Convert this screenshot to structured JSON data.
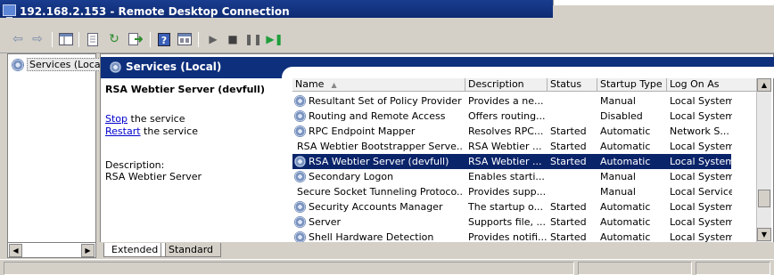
{
  "window": {
    "title": "192.168.2.153 - Remote Desktop Connection"
  },
  "tree": {
    "item_label": "Services (Local)"
  },
  "header": {
    "title": "Services (Local)"
  },
  "detail": {
    "service_name": "RSA Webtier Server (devfull)",
    "stop_link": "Stop",
    "stop_suffix": " the service",
    "restart_link": "Restart",
    "restart_suffix": " the service",
    "description_label": "Description:",
    "description_text": "RSA Webtier Server"
  },
  "columns": {
    "name": "Name",
    "description": "Description",
    "status": "Status",
    "startup": "Startup Type",
    "logon": "Log On As"
  },
  "rows": [
    {
      "name": "Resultant Set of Policy Provider",
      "description": "Provides a ne...",
      "status": "",
      "startup": "Manual",
      "logon": "Local System",
      "selected": false
    },
    {
      "name": "Routing and Remote Access",
      "description": "Offers routing...",
      "status": "",
      "startup": "Disabled",
      "logon": "Local System",
      "selected": false
    },
    {
      "name": "RPC Endpoint Mapper",
      "description": "Resolves RPC...",
      "status": "Started",
      "startup": "Automatic",
      "logon": "Network S...",
      "selected": false
    },
    {
      "name": "RSA Webtier Bootstrapper Serve...",
      "description": "RSA Webtier ...",
      "status": "Started",
      "startup": "Automatic",
      "logon": "Local System",
      "selected": false
    },
    {
      "name": "RSA Webtier Server (devfull)",
      "description": "RSA Webtier ...",
      "status": "Started",
      "startup": "Automatic",
      "logon": "Local System",
      "selected": true
    },
    {
      "name": "Secondary Logon",
      "description": "Enables starti...",
      "status": "",
      "startup": "Manual",
      "logon": "Local System",
      "selected": false
    },
    {
      "name": "Secure Socket Tunneling Protoco...",
      "description": "Provides supp...",
      "status": "",
      "startup": "Manual",
      "logon": "Local Service",
      "selected": false
    },
    {
      "name": "Security Accounts Manager",
      "description": "The startup o...",
      "status": "Started",
      "startup": "Automatic",
      "logon": "Local System",
      "selected": false
    },
    {
      "name": "Server",
      "description": "Supports file, ...",
      "status": "Started",
      "startup": "Automatic",
      "logon": "Local System",
      "selected": false
    },
    {
      "name": "Shell Hardware Detection",
      "description": "Provides notifi...",
      "status": "Started",
      "startup": "Automatic",
      "logon": "Local System",
      "selected": false
    }
  ],
  "tabs": {
    "extended": "Extended",
    "standard": "Standard"
  },
  "colors": {
    "selection": "#0a246a",
    "header_band": "#0d2f7c",
    "link": "#0000cc"
  }
}
